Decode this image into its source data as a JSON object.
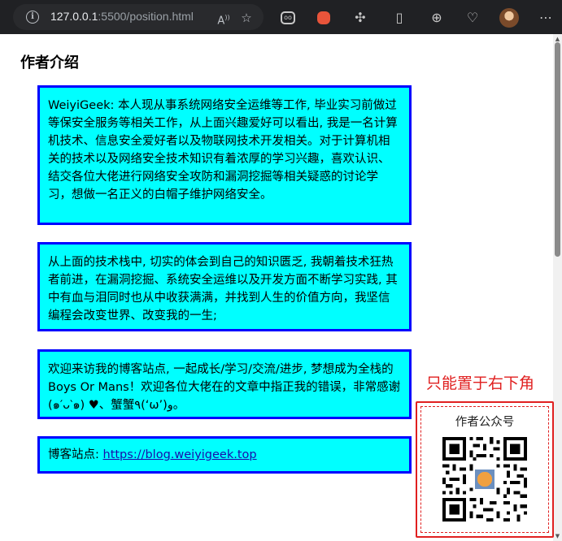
{
  "browser": {
    "url_host": "127.0.0.1",
    "url_rest": ":5500/position.html",
    "icons": [
      "info-icon",
      "read-aloud-icon",
      "favorite-star-icon",
      "extension-icon",
      "extension-icon",
      "puzzle-icon",
      "split-screen-icon",
      "collections-icon",
      "health-icon",
      "profile-avatar",
      "more-icon"
    ]
  },
  "page": {
    "heading": "作者介绍",
    "cards": [
      "WeiyiGeek: 本人现从事系统网络安全运维等工作, 毕业实习前做过等保安全服务等相关工作，从上面兴趣爱好可以看出, 我是一名计算机技术、信息安全爱好者以及物联网技术开发相关。对于计算机相关的技术以及网络安全技术知识有着浓厚的学习兴趣，喜欢认识、结交各位大佬进行网络安全攻防和漏洞挖掘等相关疑惑的讨论学习，想做一名正义的白帽子维护网络安全。",
      "从上面的技术栈中, 切实的体会到自己的知识匮乏, 我朝着技术狂热者前进，在漏洞挖掘、系统安全运维以及开发方面不断学习实践, 其中有血与泪同时也从中收获满满，并找到人生的价值方向，我坚信编程会改变世界、改变我的一生;",
      "欢迎来访我的博客站点, 一起成长/学习/交流/进步, 梦想成为全栈的Boys Or Mans！欢迎各位大佬在的文章中指正我的错误，非常感谢 (๑′ᴗ‵๑) ♥、蟹蟹٩(‘ω’)و。"
    ],
    "blog_label": "博客站点: ",
    "blog_link": "https://blog.weiyigeek.top",
    "notice": "只能置于右下角",
    "qr_caption": "作者公众号"
  },
  "colors": {
    "card_bg": "#00ffff",
    "card_border": "#0000ff",
    "notice": "#e02020"
  }
}
